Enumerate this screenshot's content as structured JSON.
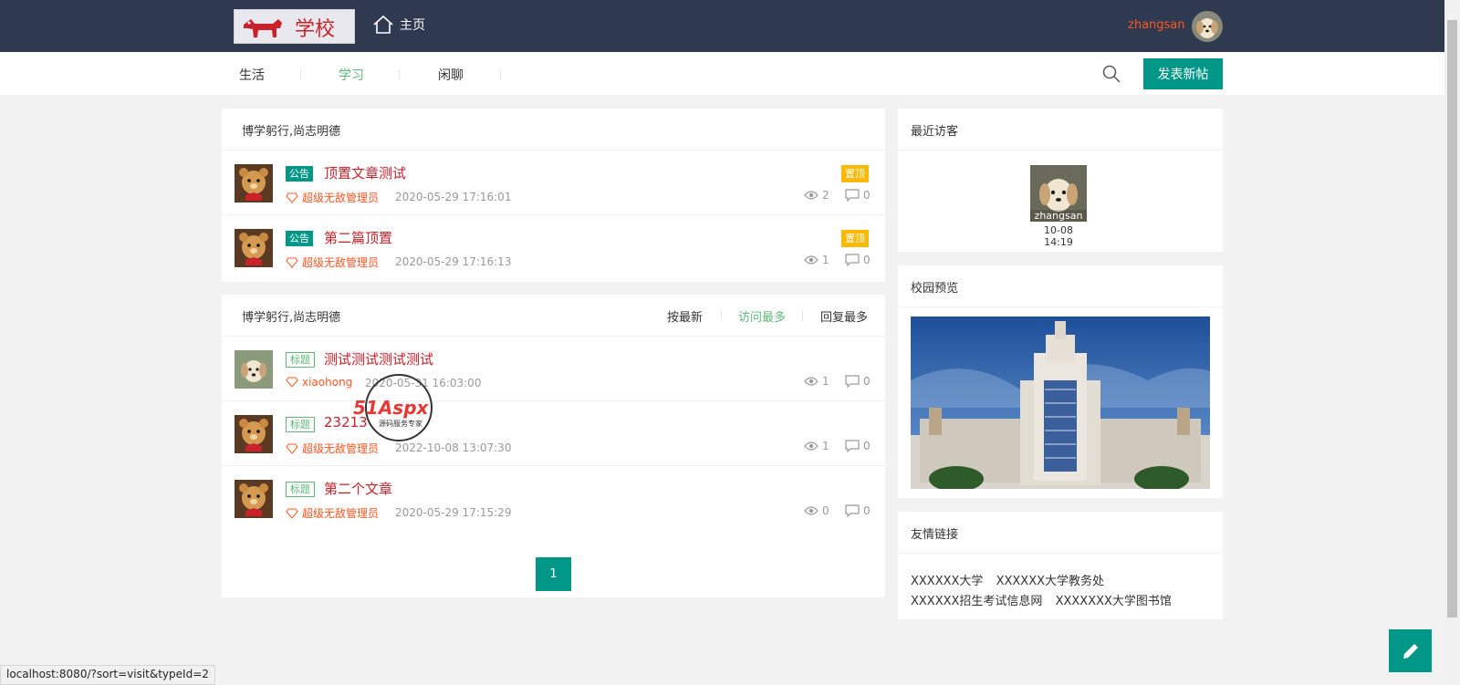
{
  "header": {
    "logo_text": "学校",
    "home_label": "主页",
    "username": "zhangsan"
  },
  "nav": {
    "items": [
      "生活",
      "学习",
      "闲聊"
    ],
    "active": "学习",
    "post_button": "发表新帖"
  },
  "pinned": {
    "heading": "博学躬行,尚志明德",
    "posts": [
      {
        "tag": "公告",
        "title": "顶置文章测试",
        "author": "超级无敌管理员",
        "time": "2020-05-29 17:16:01",
        "pin": "置顶",
        "views": "2",
        "comments": "0"
      },
      {
        "tag": "公告",
        "title": "第二篇顶置",
        "author": "超级无敌管理员",
        "time": "2020-05-29 17:16:13",
        "pin": "置顶",
        "views": "1",
        "comments": "0"
      }
    ]
  },
  "list": {
    "heading": "博学躬行,尚志明德",
    "sort_options": [
      "按最新",
      "访问最多",
      "回复最多"
    ],
    "sort_active": "访问最多",
    "posts": [
      {
        "tag": "标题",
        "title": "测试测试测试测试",
        "author": "xiaohong",
        "time": "2020-05-31 16:03:00",
        "views": "1",
        "comments": "0"
      },
      {
        "tag": "标题",
        "title": "23213",
        "author": "超级无敌管理员",
        "time": "2022-10-08 13:07:30",
        "views": "1",
        "comments": "0"
      },
      {
        "tag": "标题",
        "title": "第二个文章",
        "author": "超级无敌管理员",
        "time": "2020-05-29 17:15:29",
        "views": "0",
        "comments": "0"
      }
    ],
    "page": "1"
  },
  "sidebar": {
    "visitors_title": "最近访客",
    "visitor": {
      "name": "zhangsan",
      "time": "10-08 14:19"
    },
    "campus_title": "校园预览",
    "links_title": "友情链接",
    "links": [
      "XXXXXX大学",
      "XXXXXX大学教务处",
      "XXXXXX招生考试信息网",
      "XXXXXXX大学图书馆"
    ]
  },
  "status_url": "localhost:8080/?sort=visit&typeId=2",
  "watermark": {
    "brand": "51Aspx",
    "tagline": "源码服务专家"
  },
  "colors": {
    "header_bg": "#2f3a50",
    "accent": "#009688",
    "active_green": "#5fb878",
    "title_red": "#c9222b",
    "author_orange": "#ff5722",
    "pin_yellow": "#ffb800"
  }
}
